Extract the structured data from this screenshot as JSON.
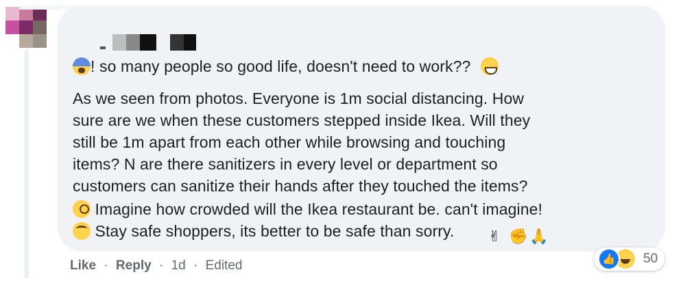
{
  "comment": {
    "author_redacted": true,
    "lines": [
      "! so many people so good life, doesn't need to work??",
      "As we seen from photos. Everyone is 1m social distancing. How",
      "sure are we when these customers stepped inside Ikea. Will they",
      "still be 1m apart from each other while browsing and touching",
      "items? N are there sanitizers in every level or department so",
      "customers can sanitize their hands after they touched the items?",
      "Imagine how crowded will the Ikea restaurant be. can't imagine!",
      "Stay safe shoppers, its better to be safe than sorry."
    ],
    "emojis": {
      "line1_lead": "fearful-face-icon",
      "line1_trail": "grinning-sweat-icon",
      "line7_lead": "face-with-monocle-icon",
      "line8_lead": "face-rolling-eyes-icon",
      "line8_trail": [
        "victory-hand-icon",
        "oncoming-fist-icon",
        "folded-hands-icon"
      ]
    },
    "trail_glyphs": [
      "✌",
      "✊",
      "🙏"
    ]
  },
  "actions": {
    "like": "Like",
    "reply": "Reply",
    "time": "1d",
    "edited": "Edited",
    "separator": "·"
  },
  "reactions": {
    "count": "50",
    "like_glyph": "👍",
    "types": [
      "like",
      "haha"
    ]
  },
  "colors": {
    "bubble": "#f0f2f5",
    "meta_text": "#65676b",
    "like_blue": "#1877f2"
  }
}
